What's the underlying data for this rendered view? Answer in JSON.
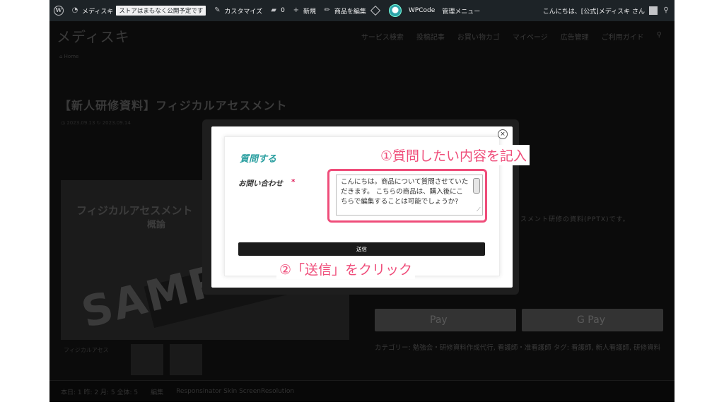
{
  "admin_bar": {
    "site_name": "メディスキ",
    "store_notice": "ストアはまもなく公開予定です",
    "customize": "カスタマイズ",
    "comments_count": "0",
    "new": "新規",
    "edit_product": "商品を編集",
    "wpcode": "WPCode",
    "admin_menu": "管理メニュー",
    "greeting": "こんにちは、[公式]メディスキ さん"
  },
  "site": {
    "logo": "メディスキ",
    "nav": [
      "サービス検索",
      "投稿記事",
      "お買い物カゴ",
      "マイページ",
      "広告管理",
      "ご利用ガイド"
    ]
  },
  "page": {
    "breadcrumb": "⌂ Home",
    "title": "【新人研修資料】フィジカルアセスメント",
    "dates": "◷ 2023.09.13  ↻ 2023.09.14",
    "product_title": "フィジカルアセスメント",
    "product_subtitle": "概論",
    "sample": "SAMP",
    "description": "スメント研修の資料(PPTX)です。",
    "apple_pay": " Pay",
    "google_pay": "G Pay",
    "categories": "カテゴリー: 勉強会・研修資料作成代行, 看護師・准看護師 タグ: 看護師, 新人看護師, 研修資料",
    "thumb_label": "フィジカルアセス"
  },
  "bottom_bar": {
    "stats": "本日: 1  昨: 2  月: 5  全体: 5",
    "edit": "編集",
    "links": "Responsinator  Skin ScreenResolution"
  },
  "dialog": {
    "title": "質問する",
    "field_label": "お問い合わせ",
    "required_mark": "*",
    "message": "こんにちは。商品について質問させていただきます。\nこちらの商品は、購入後にこちらで編集することは可能でしょうか?",
    "submit_label": "送信",
    "close_symbol": "×"
  },
  "annotations": {
    "step1": "①質問したい内容を記入",
    "step2": "②「送信」をクリック",
    "accent_color": "#ef4d7a"
  }
}
